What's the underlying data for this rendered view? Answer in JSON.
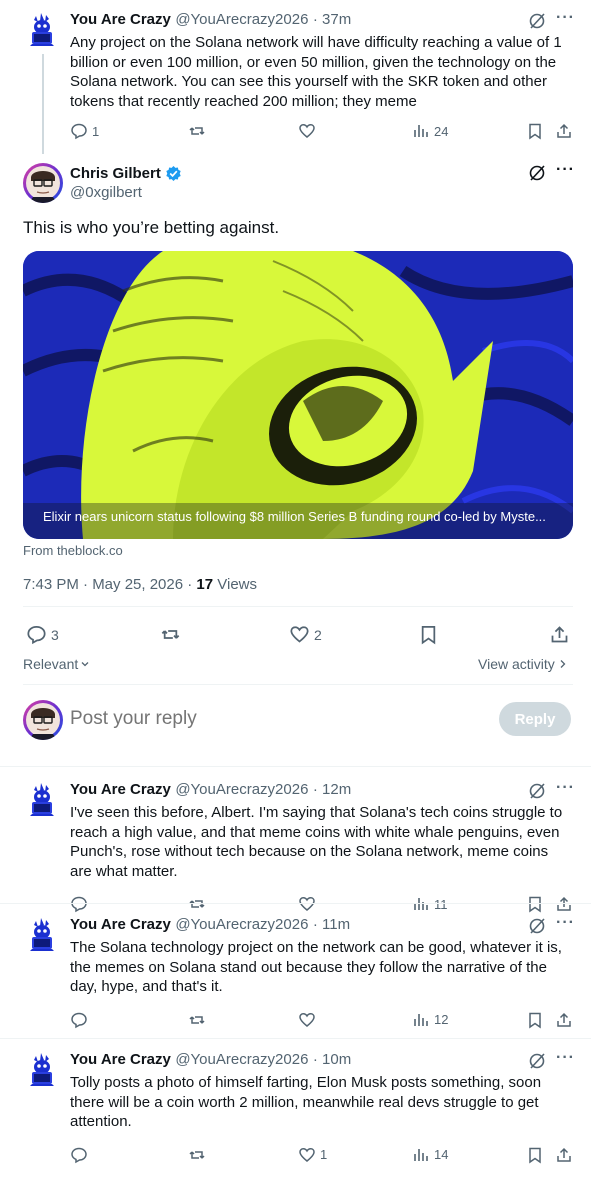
{
  "tweet1": {
    "name": "You Are Crazy",
    "handle": "@YouArecrazy2026",
    "time": "· 37m",
    "text": "Any project on the Solana network will have difficulty reaching a value of 1 billion or even 100 million, or even 50 million, given the technology on the Solana network. You can see this yourself with the SKR token and other tokens that recently reached 200 million; they meme",
    "replies": "1",
    "views": "24"
  },
  "main": {
    "name": "Chris Gilbert",
    "handle": "@0xgilbert",
    "text": "This is who you’re betting against.",
    "card_caption": "Elixir nears unicorn status following $8 million Series B funding round co-led by Myste...",
    "card_source": "From theblock.co",
    "timestamp": "7:43 PM · May 25, 2026 · ",
    "views_count": "17",
    "views_label": " Views",
    "replies": "3",
    "likes": "2",
    "relevant_label": "Relevant",
    "view_activity_label": "View activity"
  },
  "composer": {
    "placeholder": "Post your reply",
    "reply_button": "Reply"
  },
  "replies": [
    {
      "name": "You Are Crazy",
      "handle": "@YouArecrazy2026",
      "time": "· 12m",
      "text": "I've seen this before, Albert. I'm saying that Solana's tech coins struggle to reach a high value, and that meme coins with white whale penguins, even Punch's, rose without tech because on the Solana network, meme coins are what matter.",
      "likes": "",
      "views": "11"
    },
    {
      "name": "You Are Crazy",
      "handle": "@YouArecrazy2026",
      "time": "· 11m",
      "text": "The Solana technology project on the network can be good, whatever it is, the memes on Solana stand out because they follow the narrative of the day, hype, and that's it.",
      "likes": "",
      "views": "12"
    },
    {
      "name": "You Are Crazy",
      "handle": "@YouArecrazy2026",
      "time": "· 10m",
      "text": "Tolly posts a photo of himself farting, Elon Musk posts something, soon there will be a coin worth 2 million, meanwhile real devs struggle to get attention.",
      "likes": "1",
      "views": "14"
    }
  ],
  "colors": {
    "accent": "#1d9bf0",
    "text": "#0f1419",
    "secondary": "#536471",
    "border": "#eff3f4",
    "card_lime": "#d8f83a",
    "card_blue": "#1a2fd0"
  }
}
